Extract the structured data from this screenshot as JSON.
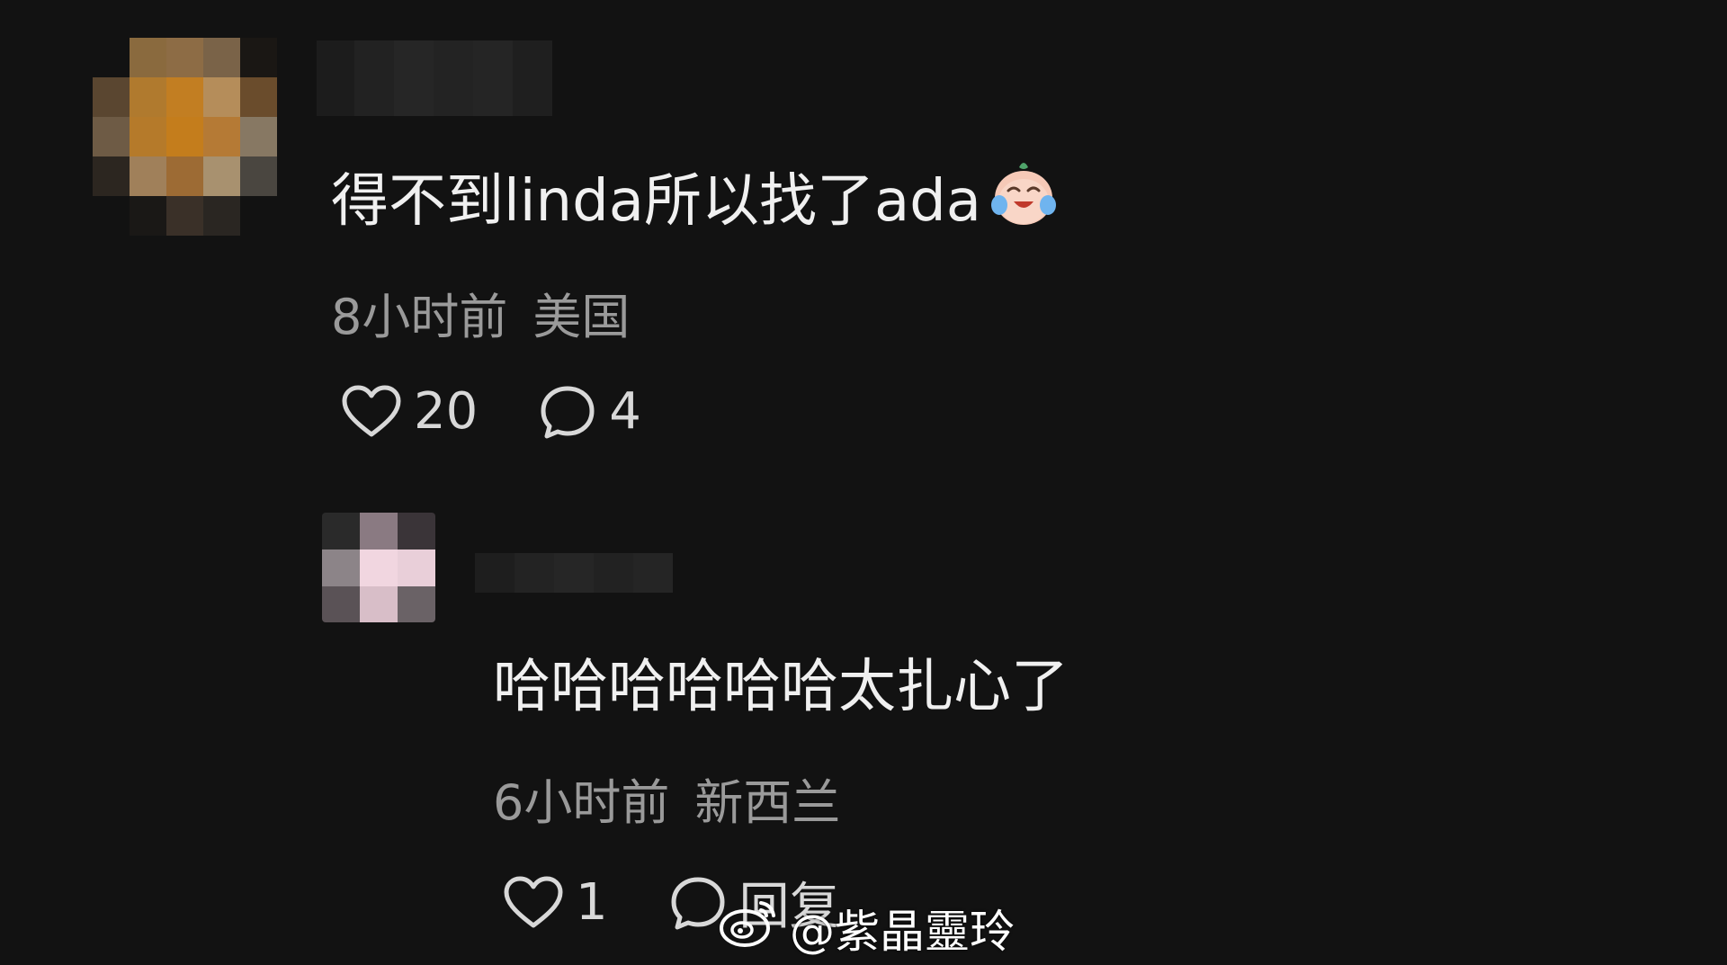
{
  "comments": [
    {
      "text": "得不到linda所以找了ada",
      "emoji": "crying-laughing-face-icon",
      "time": "8小时前",
      "location": "美国",
      "likes": "20",
      "replies": "4"
    },
    {
      "text": "哈哈哈哈哈哈太扎心了",
      "time": "6小时前",
      "location": "新西兰",
      "likes": "1",
      "reply_label": "回复"
    }
  ],
  "watermark": {
    "handle": "@紫晶靈玲",
    "icon": "weibo-logo-icon"
  },
  "colors": {
    "background": "#121212",
    "text": "#f0f0f0",
    "meta": "#9a9a9a",
    "icons": "#d8d8d8"
  }
}
